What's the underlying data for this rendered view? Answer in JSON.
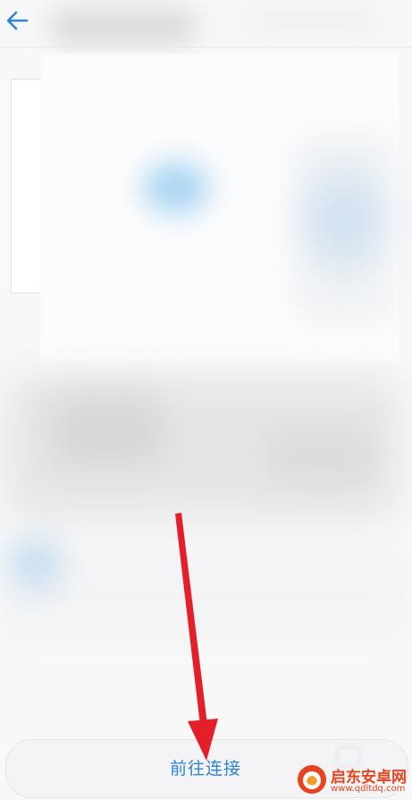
{
  "header": {
    "back_icon": "arrow-left-icon"
  },
  "footer": {
    "connect_label": "前往连接"
  },
  "watermark": {
    "title": "启东安卓网",
    "domain": "www.qdltdq.com",
    "logo_icon": "watermark-logo-icon"
  },
  "colors": {
    "accent": "#2b84d8",
    "arrow": "#e3202a",
    "watermark": "#e8431f"
  }
}
